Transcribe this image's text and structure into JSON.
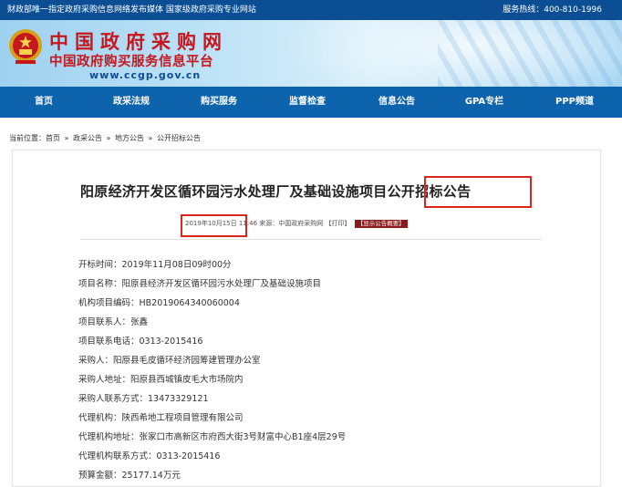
{
  "topbar": {
    "left_text": "财政部唯一指定政府采购信息网络发布媒体 国家级政府采购专业网站",
    "hotline": "服务热线：400-810-1996"
  },
  "header": {
    "logo_title": "中国政府采购网",
    "logo_subtitle": "中国政府购买服务信息平台",
    "logo_url": "www.ccgp.gov.cn",
    "emblem_icon": "national-emblem-icon"
  },
  "nav": {
    "items": [
      "首页",
      "政采法规",
      "购买服务",
      "监督检查",
      "信息公告",
      "GPA专栏",
      "PPP频道"
    ]
  },
  "breadcrumb": {
    "items": [
      "当前位置：首页",
      "»",
      "政采公告",
      "»",
      "地方公告",
      "»",
      "公开招标公告"
    ]
  },
  "article": {
    "title": "阳原经济开发区循环园污水处理厂及基础设施项目公开招标公告",
    "date": "2019年10月15日",
    "meta_tail": "11:46 来源：中国政府采购网 【打印】",
    "badge": "【显示公告概要】"
  },
  "fields": [
    "开标时间：2019年11月08日09时00分",
    "项目名称：阳原县经济开发区循环园污水处理厂及基础设施项目",
    "机构项目编码：HB2019064340060004",
    "项目联系人：张鑫",
    "项目联系电话：0313-2015416",
    "采购人：阳原县毛皮循环经济园筹建管理办公室",
    "采购人地址：阳原县西城镇皮毛大市场院内",
    "采购人联系方式：13473329121",
    "代理机构：陕西希地工程项目管理有限公司",
    "代理机构地址：张家口市高新区市府西大街3号财富中心B1座4层29号",
    "代理机构联系方式：0313-2015416",
    "预算金额：25177.14万元"
  ],
  "colors": {
    "topbar": "#0b4e93",
    "nav": "#0e63ad",
    "logo_red": "#c8161d",
    "highlight": "#d9271e"
  }
}
